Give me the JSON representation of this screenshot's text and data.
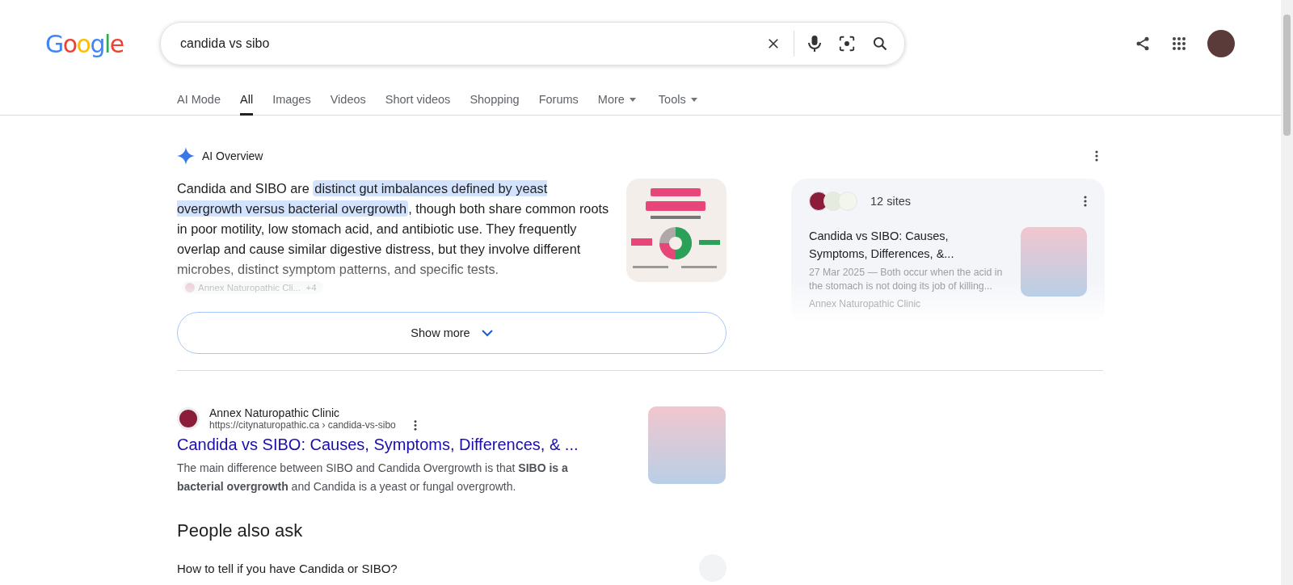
{
  "logo": "Google",
  "search": {
    "value": "candida vs sibo"
  },
  "tabs": [
    {
      "label": "AI Mode",
      "selected": false,
      "dropdown": false
    },
    {
      "label": "All",
      "selected": true,
      "dropdown": false
    },
    {
      "label": "Images",
      "selected": false,
      "dropdown": false
    },
    {
      "label": "Videos",
      "selected": false,
      "dropdown": false
    },
    {
      "label": "Short videos",
      "selected": false,
      "dropdown": false
    },
    {
      "label": "Shopping",
      "selected": false,
      "dropdown": false
    },
    {
      "label": "Forums",
      "selected": false,
      "dropdown": false
    },
    {
      "label": "More",
      "selected": false,
      "dropdown": true
    },
    {
      "label": "Tools",
      "selected": false,
      "dropdown": true
    }
  ],
  "ai_overview": {
    "title": "AI Overview",
    "paragraph": {
      "before": "Candida and SIBO are ",
      "highlight": "distinct gut imbalances defined by yeast overgrowth versus bacterial overgrowth",
      "after": ", though both share common roots in poor motility, low stomach acid, and antibiotic use. They frequently overlap and cause similar digestive distress, but they involve different microbes, distinct symptom patterns, and specific tests."
    },
    "source_chip": {
      "name": "Annex Naturopathic Cli...",
      "more": "+4"
    },
    "show_more": "Show more",
    "sources_card": {
      "count": "12 sites",
      "title": "Candida vs SIBO: Causes, Symptoms, Differences, &...",
      "snippet": "27 Mar 2025 — Both occur when the acid in the stomach is not doing its job of killing...",
      "next_source": "Annex Naturopathic Clinic"
    }
  },
  "result": {
    "site": "Annex Naturopathic Clinic",
    "url": "https://citynaturopathic.ca › candida-vs-sibo",
    "title": "Candida vs SIBO: Causes, Symptoms, Differences, & ...",
    "snippet": "The main difference between SIBO and Candida Overgrowth is that **SIBO is a bacterial overgrowth** and Candida is a yeast or fungal overgrowth."
  },
  "people_also_ask": {
    "title": "People also ask",
    "questions": [
      "How to tell if you have Candida or SIBO?"
    ]
  }
}
